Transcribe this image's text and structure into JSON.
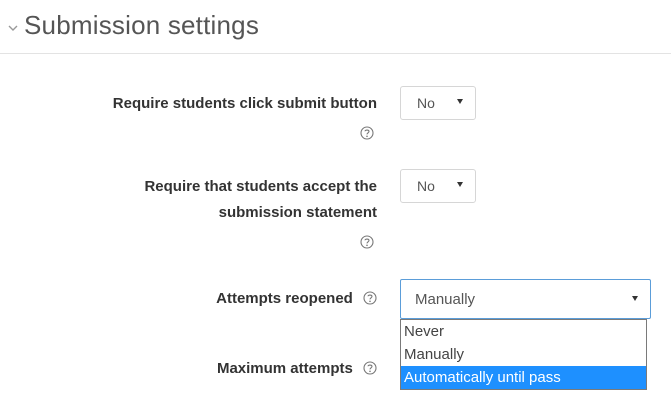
{
  "section": {
    "title": "Submission settings",
    "collapse_icon": "chevron-down-icon"
  },
  "fields": {
    "require_submit": {
      "label": "Require students click submit button",
      "help_icon": "help-icon",
      "value": "No"
    },
    "require_accept": {
      "label_line1": "Require that students accept the",
      "label_line2": "submission statement",
      "help_icon": "help-icon",
      "value": "No"
    },
    "attempts_reopened": {
      "label": "Attempts reopened",
      "help_icon": "help-icon",
      "value": "Manually",
      "options": [
        "Never",
        "Manually",
        "Automatically until pass"
      ],
      "highlighted_option": "Automatically until pass"
    },
    "maximum_attempts": {
      "label": "Maximum attempts",
      "help_icon": "help-icon"
    }
  },
  "colors": {
    "highlight": "#1e90ff",
    "focus_border": "#5b9dd9"
  }
}
